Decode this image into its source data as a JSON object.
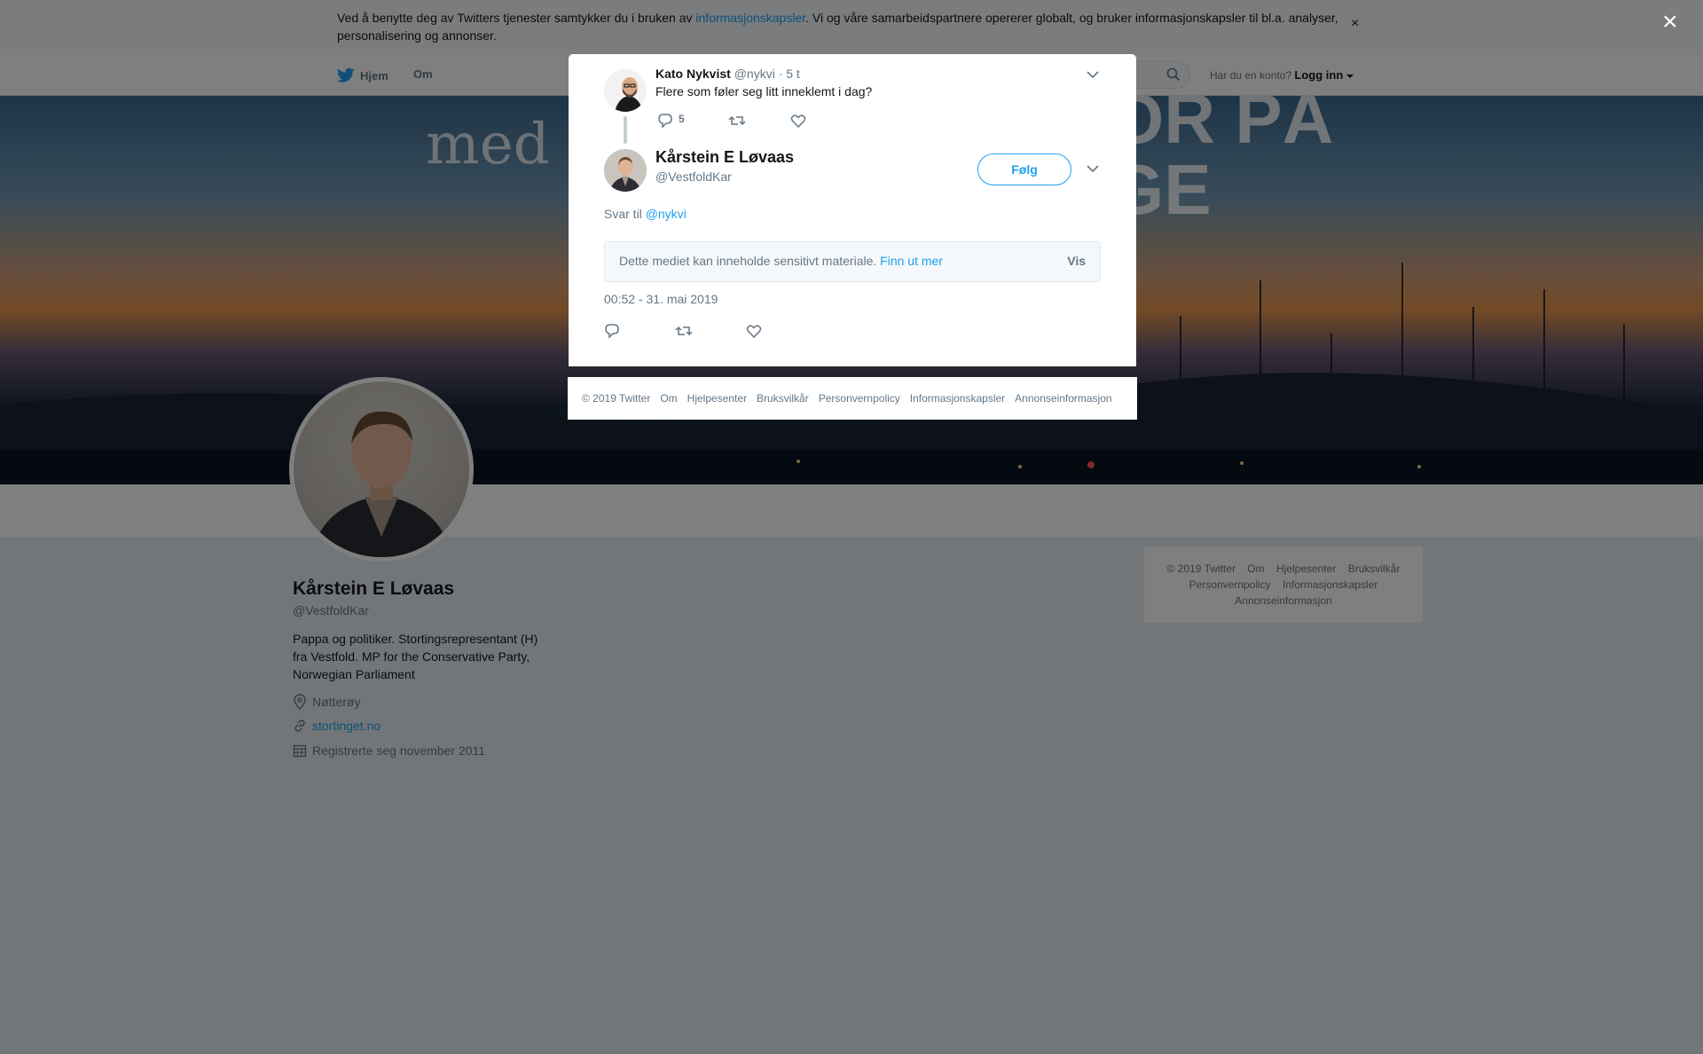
{
  "cookie_bar": {
    "text_before": "Ved å benytte deg av Twitters tjenester samtykker du i bruken av ",
    "link": "informasjonskapsler",
    "text_after": ". Vi og våre samarbeidspartnere opererer globalt, og bruker informasjonskapsler til bl.a. analyser, personalisering og annonser.",
    "close": "×"
  },
  "nav": {
    "home": "Hjem",
    "about": "Om",
    "login_prompt": "Har du en konto?",
    "login": "Logg inn"
  },
  "banner": {
    "line1": "med",
    "line2": "OR PÅ",
    "line3": "GE"
  },
  "profile": {
    "name": "Kårstein E Løvaas",
    "handle": "@VestfoldKar",
    "bio": "Pappa og politiker. Stortingsrepresentant (H) fra Vestfold. MP for the Conservative Party, Norwegian Parliament",
    "location": "Nøtterøy",
    "website": "stortinget.no",
    "joined": "Registrerte seg november 2011"
  },
  "right_footer": {
    "items": [
      "© 2019 Twitter",
      "Om",
      "Hjelpesenter",
      "Bruksvilkår",
      "Personvernpolicy",
      "Informasjonskapsler",
      "Annonseinformasjon"
    ]
  },
  "overlay": {
    "close": "×"
  },
  "parent_tweet": {
    "name": "Kato Nykvist",
    "handle": "@nykvi",
    "time": "· 5 t",
    "text": "Flere som føler seg litt inneklemt i dag?",
    "reply_count": "5"
  },
  "tweet": {
    "name": "Kårstein E Løvaas",
    "handle": "@VestfoldKar",
    "follow": "Følg",
    "reply_to_label": "Svar til",
    "reply_to_handle": "@nykvi",
    "sensitive_text": "Dette mediet kan inneholde sensitivt materiale.",
    "sensitive_link": "Finn ut mer",
    "sensitive_show": "Vis",
    "timestamp": "00:52 - 31. mai 2019"
  },
  "modal_footer": {
    "items": [
      "© 2019 Twitter",
      "Om",
      "Hjelpesenter",
      "Bruksvilkår",
      "Personvernpolicy",
      "Informasjonskapsler",
      "Annonseinformasjon"
    ]
  },
  "colors": {
    "accent": "#1da1f2",
    "muted": "#657786",
    "text": "#14171a",
    "background": "#e6ecf0"
  },
  "icons": [
    "twitter-bird-icon",
    "search-icon",
    "caret-down-icon",
    "location-icon",
    "link-icon",
    "calendar-icon",
    "reply-icon",
    "retweet-icon",
    "like-icon",
    "chevron-down-icon",
    "close-icon"
  ]
}
